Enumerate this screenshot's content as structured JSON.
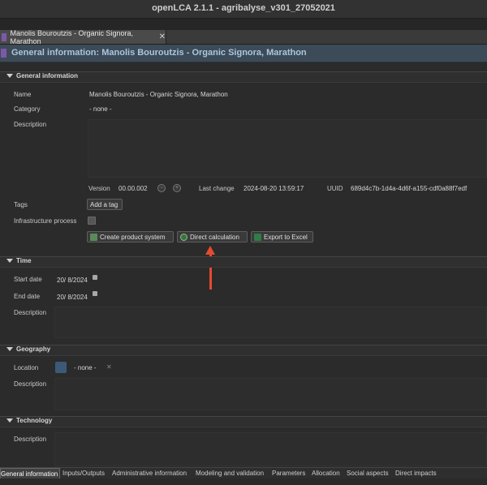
{
  "window": {
    "title": "openLCA 2.1.1 - agribalyse_v301_27052021"
  },
  "editor_tab": {
    "label": "Manolis Bouroutzis - Organic Signora, Marathon",
    "close": "✕"
  },
  "header": {
    "title": "General information: Manolis Bouroutzis - Organic Signora, Marathon"
  },
  "general": {
    "section_title": "General information",
    "name_label": "Name",
    "name_value": "Manolis Bouroutzis - Organic Signora, Marathon",
    "category_label": "Category",
    "category_value": "- none -",
    "description_label": "Description",
    "version_label": "Version",
    "version_value": "00.00.002",
    "last_change_label": "Last change",
    "last_change_value": "2024-08-20 13:59:17",
    "uuid_label": "UUID",
    "uuid_value": "689d4c7b-1d4a-4d6f-a155-cdf0a88f7edf",
    "tags_label": "Tags",
    "add_tag_label": "Add a tag",
    "infra_label": "Infrastructure process",
    "create_ps_label": "Create product system",
    "direct_calc_label": "Direct calculation",
    "export_excel_label": "Export to Excel"
  },
  "time": {
    "section_title": "Time",
    "start_label": "Start date",
    "start_value": "20/ 8/2024",
    "end_label": "End date",
    "end_value": "20/ 8/2024",
    "description_label": "Description"
  },
  "geography": {
    "section_title": "Geography",
    "location_label": "Location",
    "location_value": "- none -",
    "clear": "✕",
    "description_label": "Description"
  },
  "technology": {
    "section_title": "Technology",
    "description_label": "Description"
  },
  "bottom_tabs": [
    "General information",
    "Inputs/Outputs",
    "Administrative information",
    "Modeling and validation",
    "Parameters",
    "Allocation",
    "Social aspects",
    "Direct impacts"
  ],
  "colors": {
    "annotation_arrow": "#e34b2f",
    "header_text": "#a9c6e0",
    "tab_icon": "#7a5aa8"
  }
}
